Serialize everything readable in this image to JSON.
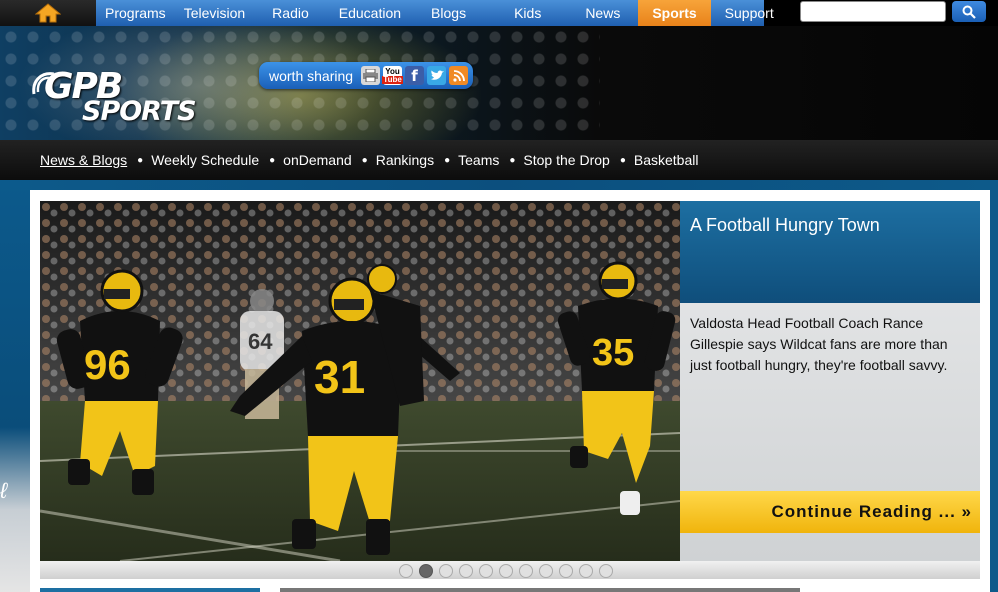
{
  "top_nav": {
    "items": [
      {
        "label": "Programs",
        "active": false
      },
      {
        "label": "Television",
        "active": false
      },
      {
        "label": "Radio",
        "active": false
      },
      {
        "label": "Education",
        "active": false
      },
      {
        "label": "Blogs",
        "active": false
      },
      {
        "label": "Kids",
        "active": false
      },
      {
        "label": "News",
        "active": false
      },
      {
        "label": "Sports",
        "active": true
      },
      {
        "label": "Support",
        "active": false
      }
    ],
    "search_value": ""
  },
  "header": {
    "logo_line1": "GPB",
    "logo_line2": "SPORTS",
    "share_label": "worth sharing",
    "share_icons": [
      "print-icon",
      "youtube-icon",
      "facebook-icon",
      "twitter-icon",
      "rss-icon"
    ]
  },
  "sub_nav": {
    "items": [
      {
        "label": "News & Blogs",
        "active": true
      },
      {
        "label": "Weekly Schedule",
        "active": false
      },
      {
        "label": "onDemand",
        "active": false
      },
      {
        "label": "Rankings",
        "active": false
      },
      {
        "label": "Teams",
        "active": false
      },
      {
        "label": "Stop the Drop",
        "active": false
      },
      {
        "label": "Basketball",
        "active": false
      }
    ]
  },
  "feature": {
    "title": "A Football Hungry Town",
    "description": "Valdosta Head Football Coach Rance Gillespie says Wildcat fans are more than just football hungry, they're football savvy.",
    "cta": "Continue Reading ... »",
    "jersey_numbers": [
      "96",
      "31",
      "35",
      "64"
    ]
  },
  "carousel": {
    "slide_count": 11,
    "active_index": 1
  },
  "colors": {
    "nav_blue": "#2f7ad0",
    "active_orange": "#f29a2c",
    "cta_yellow": "#f6c525",
    "jersey_gold": "#f2c418"
  }
}
